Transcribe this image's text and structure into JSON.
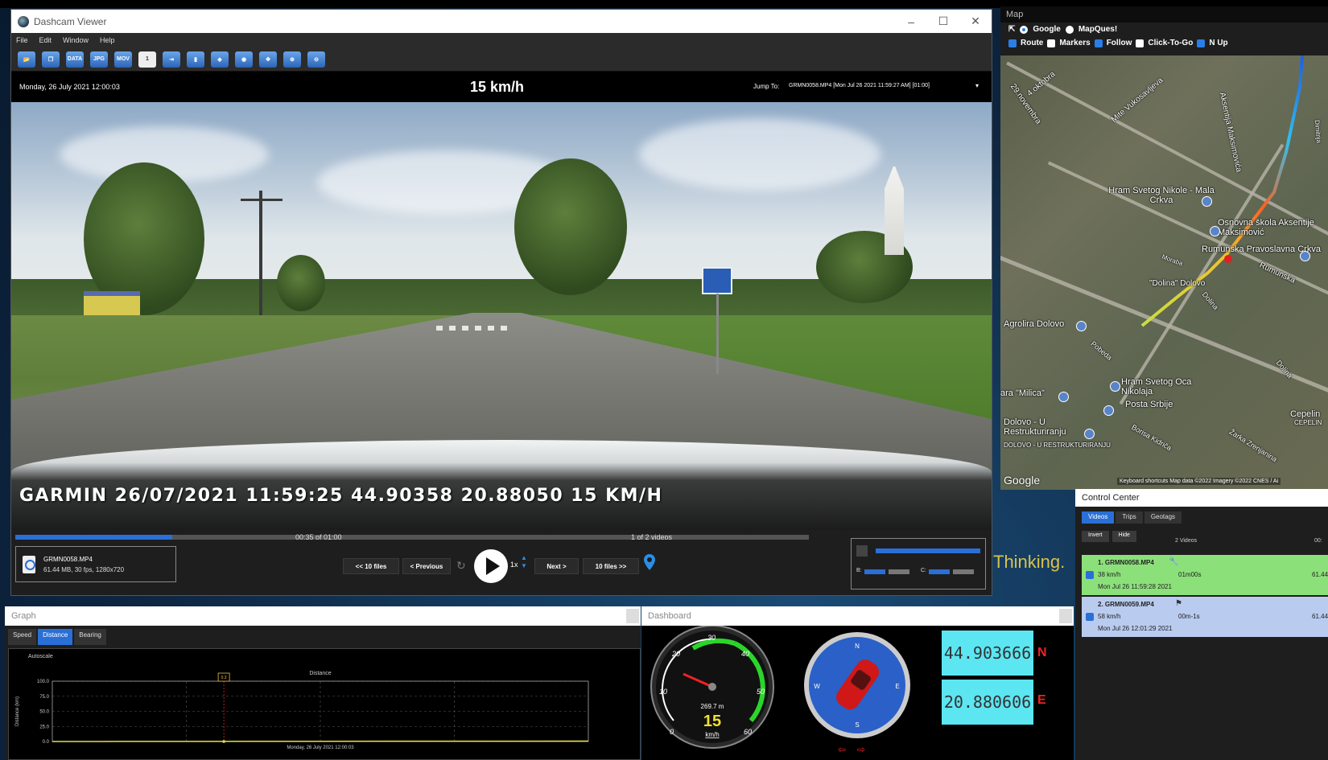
{
  "main_window": {
    "title": "Dashcam Viewer",
    "menu": [
      "File",
      "Edit",
      "Window",
      "Help"
    ],
    "toolbar_icons": [
      "open-folder-icon",
      "copy-icon",
      "data-icon",
      "jpg-icon",
      "mov-icon",
      "one-icon",
      "export-icon",
      "bookmark-icon",
      "split-icon",
      "target-icon",
      "fit-icon",
      "zoom-in-icon",
      "zoom-out-icon"
    ],
    "toolbar_labels": {
      "data": "DATA",
      "jpg": "JPG",
      "mov": "MOV",
      "one": "1"
    },
    "current_datetime": "Monday, 26 July 2021 12:00:03",
    "speed": "15 km/h",
    "jump_label": "Jump To:",
    "jump_value": "GRMN0058.MP4 [Mon Jul 26 2021 11:59:27 AM] [01:00]",
    "video_overlay": "GARMIN  26/07/2021 11:59:25  44.90358 20.88050  15 KM/H",
    "progress_time": "00:35 of 01:00",
    "progress_fraction": 0.583,
    "progress_videos": "1 of 2 videos",
    "file_name": "GRMN0058.MP4",
    "file_info": "61.44 MB, 30 fps, 1280x720",
    "nav": {
      "back10": "<< 10 files",
      "prev": "< Previous",
      "next": "Next >",
      "fwd10": "10 files >>"
    },
    "rate": "1x",
    "brightness_label": "B:",
    "contrast_label": "C:"
  },
  "desktop_text": "Thinking.",
  "map": {
    "title": "Map",
    "providers": [
      {
        "label": "Google",
        "selected": true
      },
      {
        "label": "MapQues!",
        "selected": false
      }
    ],
    "options": [
      {
        "label": "Route",
        "checked": true
      },
      {
        "label": "Markers",
        "checked": false
      },
      {
        "label": "Follow",
        "checked": true
      },
      {
        "label": "Click-To-Go",
        "checked": false
      },
      {
        "label": "N Up",
        "checked": true
      }
    ],
    "labels": {
      "l1": "29.novembra",
      "l2": "4.oktobra",
      "l3": "Mite Vukosavljeva",
      "l4": "Aksentija Maksimovića",
      "l5": "Hram Svetog Nikole - Mala Crkva",
      "l6": "Osnovna škola Aksentije Maksimović",
      "l7": "Rumunska Pravoslavna Crkva",
      "l8": "Rumunska",
      "l9": "\"Dolina\" Dolovo",
      "l10": "Dolina",
      "l11": "Agrolira Dolovo",
      "l12": "Pobeda",
      "l13": "Hram Svetog Oca Nikolaja",
      "l14": "Dolina",
      "l15": "Posta Srbije",
      "l16": "ara \"Milica\"",
      "l17": "Dolovo - U Restrukturiranju",
      "l18": "DOLOVO - U RESTRUKTURIRANJU",
      "l19": "Borisa Kidriča",
      "l20": "Cepelin",
      "l21": "CEPELIN",
      "l22": "Žarka Zrenjanina",
      "l23": "Moraba",
      "l24": "Dimitrija"
    },
    "attribution": "Keyboard shortcuts   Map data ©2022 Imagery ©2022 CNES / Ai",
    "logo": "Google"
  },
  "control_center": {
    "title": "Control Center",
    "tabs": [
      {
        "label": "Videos",
        "active": true
      },
      {
        "label": "Trips",
        "active": false
      },
      {
        "label": "Geotags",
        "active": false
      }
    ],
    "tools": [
      "Invert",
      "Hide"
    ],
    "count": "2 Videos",
    "time_header": "00:",
    "rows": [
      {
        "name": "1. GRMN0058.MP4",
        "speed": "38 km/h",
        "duration": "01m00s",
        "size": "61.44",
        "date": "Mon Jul 26 11:59:28 2021",
        "color": "#8ce07a"
      },
      {
        "name": "2. GRMN0059.MP4",
        "speed": "58 km/h",
        "duration": "00m-1s",
        "size": "61.44",
        "date": "Mon Jul 26 12:01:29 2021",
        "color": "#b9cbef"
      }
    ]
  },
  "graph": {
    "title": "Graph",
    "tabs": [
      {
        "label": "Speed",
        "active": false
      },
      {
        "label": "Distance",
        "active": true
      },
      {
        "label": "Bearing",
        "active": false
      }
    ],
    "autoscale": "Autoscale",
    "marker_label": "0.3"
  },
  "chart_data": {
    "type": "line",
    "title": "Distance",
    "xlabel": "Monday, 26 July 2021 12:00:03",
    "ylabel": "Distance (km)",
    "ylim": [
      0,
      100
    ],
    "yticks": [
      "0.0",
      "25.0",
      "50.0",
      "75.0",
      "100.0"
    ],
    "series": [
      {
        "values": [
          0,
          0.1,
          0.2,
          0.27,
          0.35,
          0.42,
          0.5,
          0.58,
          0.66
        ]
      }
    ],
    "cursor_fraction": 0.32,
    "grid": true
  },
  "dashboard": {
    "title": "Dashboard",
    "speedo_ticks": [
      "0",
      "10",
      "20",
      "30",
      "40",
      "50",
      "60"
    ],
    "speedo_distance": "269.7 m",
    "speedo_value": "15",
    "speedo_unit": "km/h",
    "compass_labels": [
      "N",
      "E",
      "S",
      "W"
    ],
    "lat": "44.903666",
    "lat_dir": "N",
    "lon": "20.880606",
    "lon_dir": "E"
  }
}
